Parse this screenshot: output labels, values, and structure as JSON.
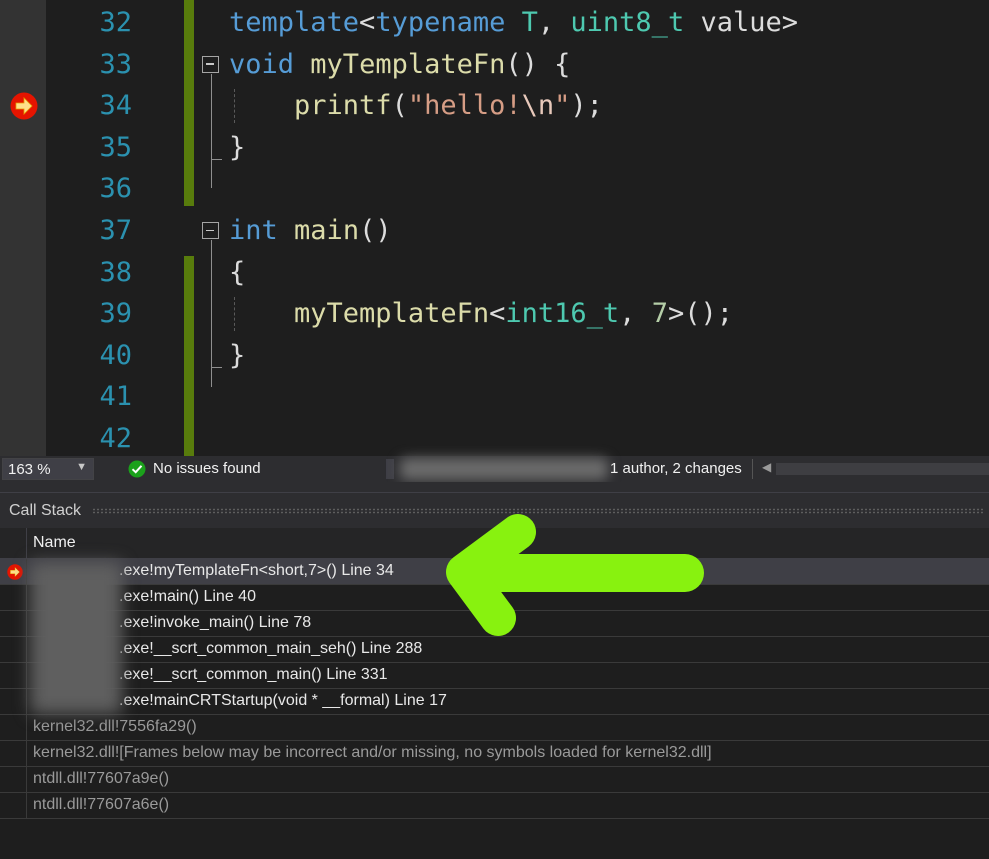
{
  "editor": {
    "lines": [
      {
        "number": "32",
        "tokens": [
          [
            "kw",
            "template"
          ],
          [
            "plain",
            "<"
          ],
          [
            "kw",
            "typename"
          ],
          [
            "plain",
            " "
          ],
          [
            "ty",
            "T"
          ],
          [
            "plain",
            ", "
          ],
          [
            "ty",
            "uint8_t"
          ],
          [
            "plain",
            " value>"
          ]
        ]
      },
      {
        "number": "33",
        "tokens": [
          [
            "kw",
            "void"
          ],
          [
            "plain",
            " "
          ],
          [
            "fn",
            "myTemplateFn"
          ],
          [
            "plain",
            "() {"
          ]
        ]
      },
      {
        "number": "34",
        "tokens": [
          [
            "plain",
            "    "
          ],
          [
            "fn",
            "printf"
          ],
          [
            "plain",
            "("
          ],
          [
            "str",
            "\"hello!"
          ],
          [
            "esc",
            "\\n"
          ],
          [
            "str",
            "\""
          ],
          [
            "plain",
            ");"
          ]
        ]
      },
      {
        "number": "35",
        "tokens": [
          [
            "plain",
            "}"
          ]
        ]
      },
      {
        "number": "36",
        "tokens": []
      },
      {
        "number": "37",
        "tokens": [
          [
            "kw",
            "int"
          ],
          [
            "plain",
            " "
          ],
          [
            "fn",
            "main"
          ],
          [
            "plain",
            "()"
          ]
        ]
      },
      {
        "number": "38",
        "tokens": [
          [
            "plain",
            "{"
          ]
        ]
      },
      {
        "number": "39",
        "tokens": [
          [
            "plain",
            "    "
          ],
          [
            "fn",
            "myTemplateFn"
          ],
          [
            "plain",
            "<"
          ],
          [
            "ty",
            "int16_t"
          ],
          [
            "plain",
            ", "
          ],
          [
            "num",
            "7"
          ],
          [
            "plain",
            ">();"
          ]
        ]
      },
      {
        "number": "40",
        "tokens": [
          [
            "plain",
            "}"
          ]
        ]
      },
      {
        "number": "41",
        "tokens": []
      },
      {
        "number": "42",
        "tokens": []
      }
    ]
  },
  "status_bar": {
    "zoom": "163 %",
    "issues": "No issues found",
    "authors": "1 author, 2 changes"
  },
  "call_stack": {
    "title": "Call Stack",
    "column_name": "Name",
    "rows": [
      {
        "text": ".exe!myTemplateFn<short,7>() Line 34",
        "kind": "user",
        "current": true
      },
      {
        "text": ".exe!main() Line 40",
        "kind": "user",
        "current": false
      },
      {
        "text": ".exe!invoke_main() Line 78",
        "kind": "user",
        "current": false
      },
      {
        "text": ".exe!__scrt_common_main_seh() Line 288",
        "kind": "user",
        "current": false
      },
      {
        "text": ".exe!__scrt_common_main() Line 331",
        "kind": "user",
        "current": false
      },
      {
        "text": ".exe!mainCRTStartup(void * __formal) Line 17",
        "kind": "user",
        "current": false
      },
      {
        "text": "kernel32.dll!7556fa29()",
        "kind": "ext",
        "current": false
      },
      {
        "text": "kernel32.dll![Frames below may be incorrect and/or missing, no symbols loaded for kernel32.dll]",
        "kind": "ext",
        "current": false
      },
      {
        "text": "ntdll.dll!77607a9e()",
        "kind": "ext",
        "current": false
      },
      {
        "text": "ntdll.dll!77607a6e()",
        "kind": "ext",
        "current": false
      }
    ]
  },
  "colors": {
    "keyword": "#569cd6",
    "type": "#4ec9b0",
    "function": "#dcdcaa",
    "string": "#d69d85",
    "line_number": "#2b91af",
    "change_bar": "#587c0c",
    "annotation_arrow": "#88f20f"
  },
  "icons": {
    "instruction_pointer": "current-statement-arrow-icon",
    "issues": "check-circle-icon",
    "annotation": "hand-drawn-green-arrow"
  }
}
